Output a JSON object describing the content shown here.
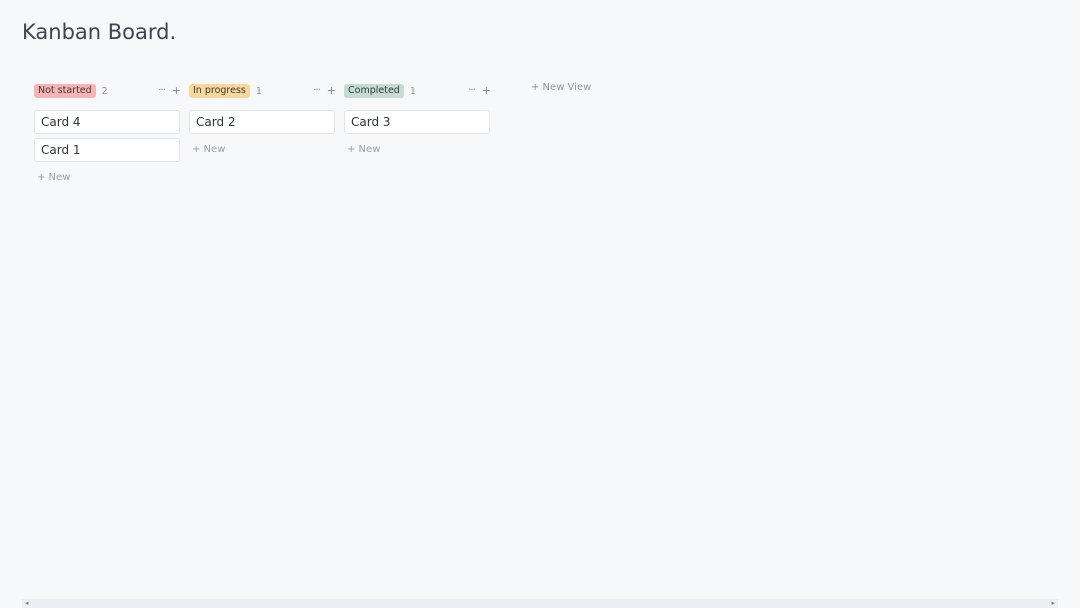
{
  "page": {
    "title": "Kanban Board."
  },
  "columns": [
    {
      "status": "Not started",
      "count": "2",
      "pill_color": "#f8b4b4",
      "more_icon": "···",
      "add_icon": "+",
      "cards": [
        "Card 4",
        "Card 1"
      ],
      "new_label": "+ New"
    },
    {
      "status": "In progress",
      "count": "1",
      "pill_color": "#f7d89a",
      "more_icon": "···",
      "add_icon": "+",
      "cards": [
        "Card 2"
      ],
      "new_label": "+ New"
    },
    {
      "status": "Completed",
      "count": "1",
      "pill_color": "#c5dcd3",
      "more_icon": "···",
      "add_icon": "+",
      "cards": [
        "Card 3"
      ],
      "new_label": "+ New"
    }
  ],
  "new_view_label": "+ New View",
  "scrollbar": {
    "left_arrow": "◂",
    "right_arrow": "▸"
  }
}
